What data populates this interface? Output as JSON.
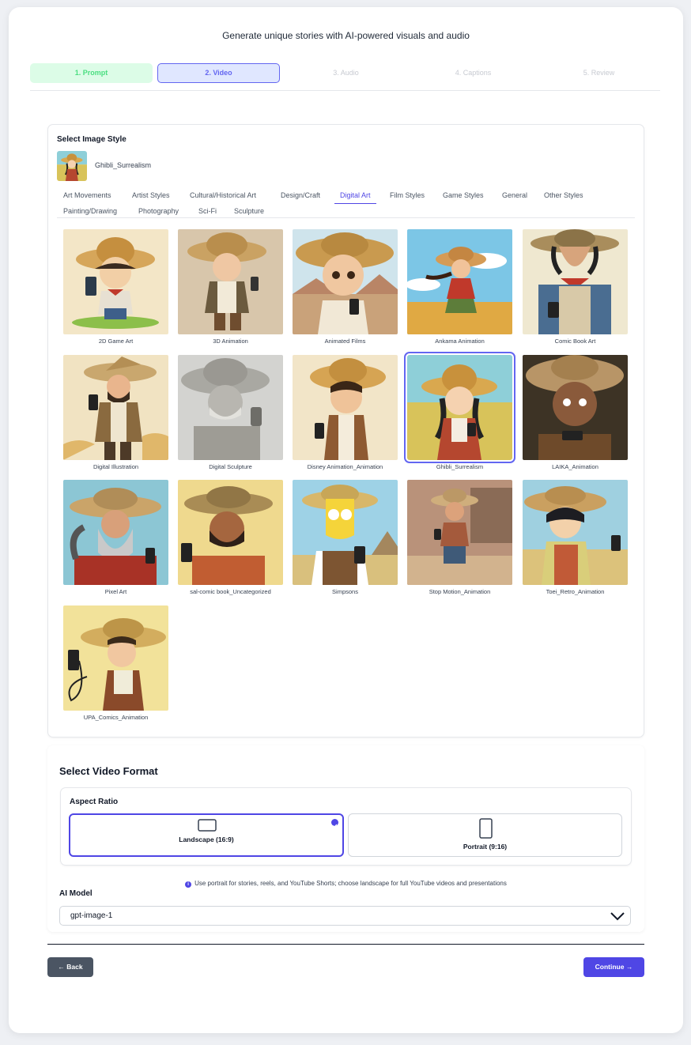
{
  "header": {
    "subtitle": "Generate unique stories with AI-powered visuals and audio"
  },
  "steps": [
    {
      "label": "1. Prompt",
      "state": "done"
    },
    {
      "label": "2. Video",
      "state": "active"
    },
    {
      "label": "3. Audio",
      "state": "todo"
    },
    {
      "label": "4. Captions",
      "state": "todo"
    },
    {
      "label": "5. Review",
      "state": "todo"
    }
  ],
  "image_style": {
    "title": "Select Image Style",
    "selected_name": "Ghibli_Surrealism",
    "tabs": [
      "Art Movements",
      "Artist Styles",
      "Cultural/Historical Art",
      "Design/Craft",
      "Digital Art",
      "Film Styles",
      "Game Styles",
      "General",
      "Other Styles",
      "Painting/Drawing",
      "Photography",
      "Sci-Fi",
      "Sculpture"
    ],
    "active_tab": "Digital Art",
    "styles": [
      "2D Game Art",
      "3D Animation",
      "Animated Films",
      "Ankama Animation",
      "Comic Book Art",
      "Digital Illustration",
      "Digital Sculpture",
      "Disney Animation_Animation",
      "Ghibli_Surrealism",
      "LAIKA_Animation",
      "Pixel Art",
      "sal-comic book_Uncategorized",
      "Simpsons",
      "Stop Motion_Animation",
      "Toei_Retro_Animation",
      "UPA_Comics_Animation"
    ]
  },
  "video_format": {
    "title": "Select Video Format",
    "aspect_ratio_label": "Aspect Ratio",
    "options": {
      "landscape": "Landscape (16:9)",
      "portrait": "Portrait (9:16)"
    },
    "selected": "landscape",
    "hint": "Use portrait for stories, reels, and YouTube Shorts; choose landscape for full YouTube videos and presentations",
    "ai_model_label": "AI Model",
    "ai_model_value": "gpt-image-1"
  },
  "nav": {
    "back": "Back",
    "continue": "Continue"
  },
  "colors": {
    "accent": "#4f46e5",
    "done_bg": "#dcfce7",
    "done_text": "#4ade80",
    "back_btn": "#4b5563"
  }
}
